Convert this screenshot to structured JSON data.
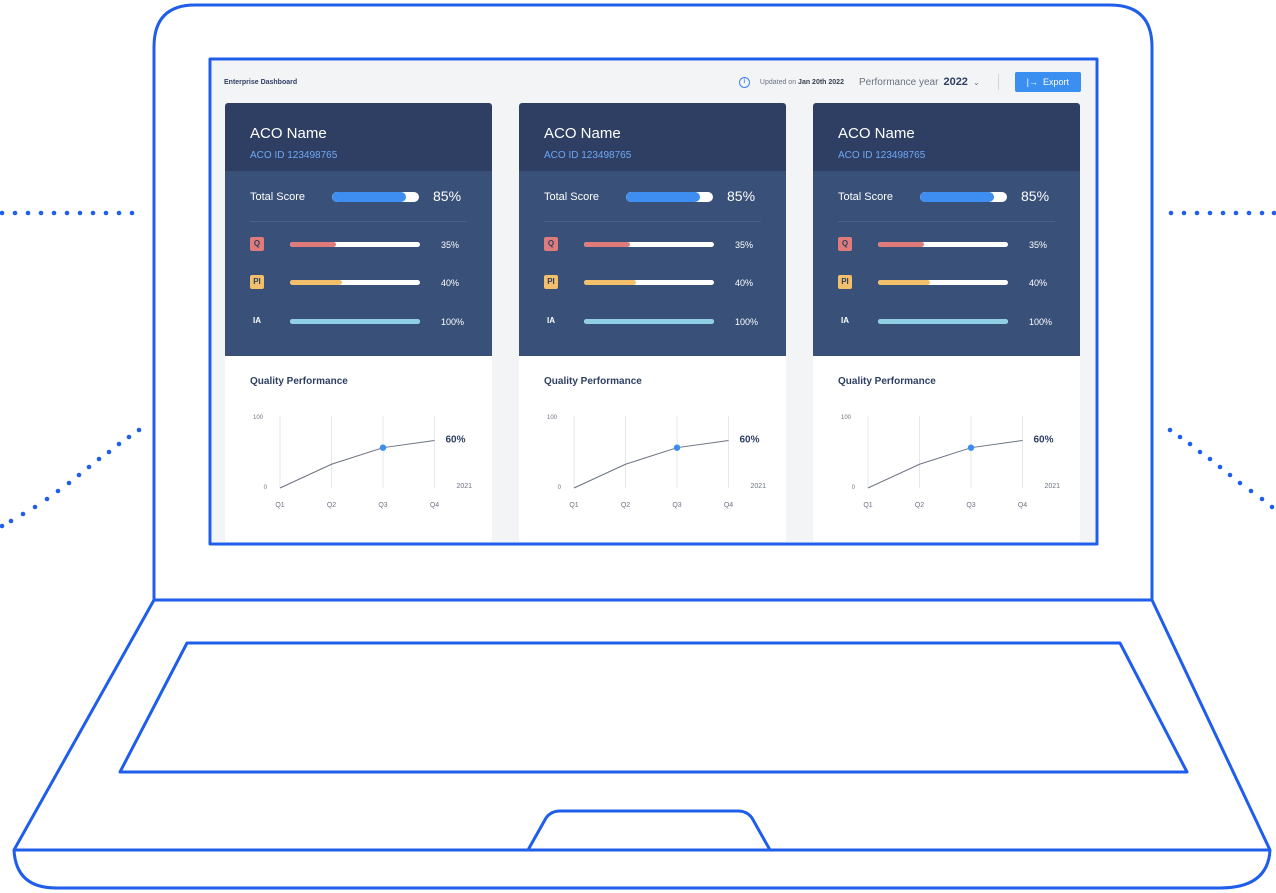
{
  "header": {
    "app_title": "Enterprise Dashboard",
    "updated_prefix": "Updated on",
    "updated_date": "Jan 20th 2022",
    "performance_year_label": "Performance year",
    "performance_year_value": "2022",
    "export_label": "Export"
  },
  "colors": {
    "accent": "#3b8ff0",
    "card_header": "#2e3f63",
    "card_body": "#395079",
    "quality": "#e07b7b",
    "promoting_interoperability": "#f2c06b",
    "improvement_activities": "#8fcfe3",
    "laptop_outline": "#1f5eea"
  },
  "cards": [
    {
      "aco_name": "ACO Name",
      "aco_id": "ACO ID 123498765",
      "total_score_label": "Total Score",
      "total_score": 85,
      "total_score_text": "85%",
      "metrics": [
        {
          "tag": "Q",
          "value": 35,
          "value_text": "35%"
        },
        {
          "tag": "PI",
          "value": 40,
          "value_text": "40%"
        },
        {
          "tag": "IA",
          "value": 100,
          "value_text": "100%"
        }
      ],
      "chart_title": "Quality Performance"
    },
    {
      "aco_name": "ACO Name",
      "aco_id": "ACO ID 123498765",
      "total_score_label": "Total Score",
      "total_score": 85,
      "total_score_text": "85%",
      "metrics": [
        {
          "tag": "Q",
          "value": 35,
          "value_text": "35%"
        },
        {
          "tag": "PI",
          "value": 40,
          "value_text": "40%"
        },
        {
          "tag": "IA",
          "value": 100,
          "value_text": "100%"
        }
      ],
      "chart_title": "Quality Performance"
    },
    {
      "aco_name": "ACO Name",
      "aco_id": "ACO ID 123498765",
      "total_score_label": "Total Score",
      "total_score": 85,
      "total_score_text": "85%",
      "metrics": [
        {
          "tag": "Q",
          "value": 35,
          "value_text": "35%"
        },
        {
          "tag": "PI",
          "value": 40,
          "value_text": "40%"
        },
        {
          "tag": "IA",
          "value": 100,
          "value_text": "100%"
        }
      ],
      "chart_title": "Quality Performance"
    }
  ],
  "chart_data": [
    {
      "type": "line",
      "title": "Quality Performance",
      "categories": [
        "Q1",
        "Q2",
        "Q3",
        "Q4"
      ],
      "series": [
        {
          "values": [
            0,
            33,
            56,
            66
          ]
        }
      ],
      "highlight_index": 2,
      "end_label": "60%",
      "year_label": "2021",
      "ylim": [
        0,
        100
      ],
      "ytick_labels": [
        "100",
        "0"
      ],
      "grid": true
    },
    {
      "type": "line",
      "title": "Quality Performance",
      "categories": [
        "Q1",
        "Q2",
        "Q3",
        "Q4"
      ],
      "series": [
        {
          "values": [
            0,
            33,
            56,
            66
          ]
        }
      ],
      "highlight_index": 2,
      "end_label": "60%",
      "year_label": "2021",
      "ylim": [
        0,
        100
      ],
      "ytick_labels": [
        "100",
        "0"
      ],
      "grid": true
    },
    {
      "type": "line",
      "title": "Quality Performance",
      "categories": [
        "Q1",
        "Q2",
        "Q3",
        "Q4"
      ],
      "series": [
        {
          "values": [
            0,
            33,
            56,
            66
          ]
        }
      ],
      "highlight_index": 2,
      "end_label": "60%",
      "year_label": "2021",
      "ylim": [
        0,
        100
      ],
      "ytick_labels": [
        "100",
        "0"
      ],
      "grid": true
    }
  ]
}
